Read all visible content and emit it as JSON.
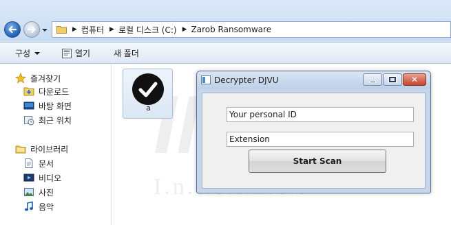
{
  "explorer": {
    "address": {
      "crumbs": [
        "컴퓨터",
        "로컬 디스크 (C:)",
        "Zarob Ransomware"
      ]
    },
    "toolbar": {
      "organize_label": "구성",
      "open_label": "열기",
      "new_folder_label": "새 폴더"
    },
    "sidebar": {
      "favorites_label": "즐겨찾기",
      "favorites": [
        "다운로드",
        "바탕 화면",
        "최근 위치"
      ],
      "libraries_label": "라이브러리",
      "libraries": [
        "문서",
        "비디오",
        "사진",
        "음악"
      ]
    },
    "file": {
      "name": "a",
      "icon": "checkmark-circle-icon"
    },
    "watermark": {
      "brand": "INCA",
      "tagline": "I.n.t.e.r.n.e.t"
    }
  },
  "dialog": {
    "title": "Decrypter DJVU",
    "id_field_value": "Your personal ID",
    "extension_field_value": "Extension",
    "scan_button_label": "Start Scan",
    "close_glyph": "✕"
  },
  "colors": {
    "address_bar": "#c9dcf3",
    "toolbar": "#dfe9f5",
    "dialog_frame": "#c5d6ea",
    "close_button": "#c7442c"
  }
}
